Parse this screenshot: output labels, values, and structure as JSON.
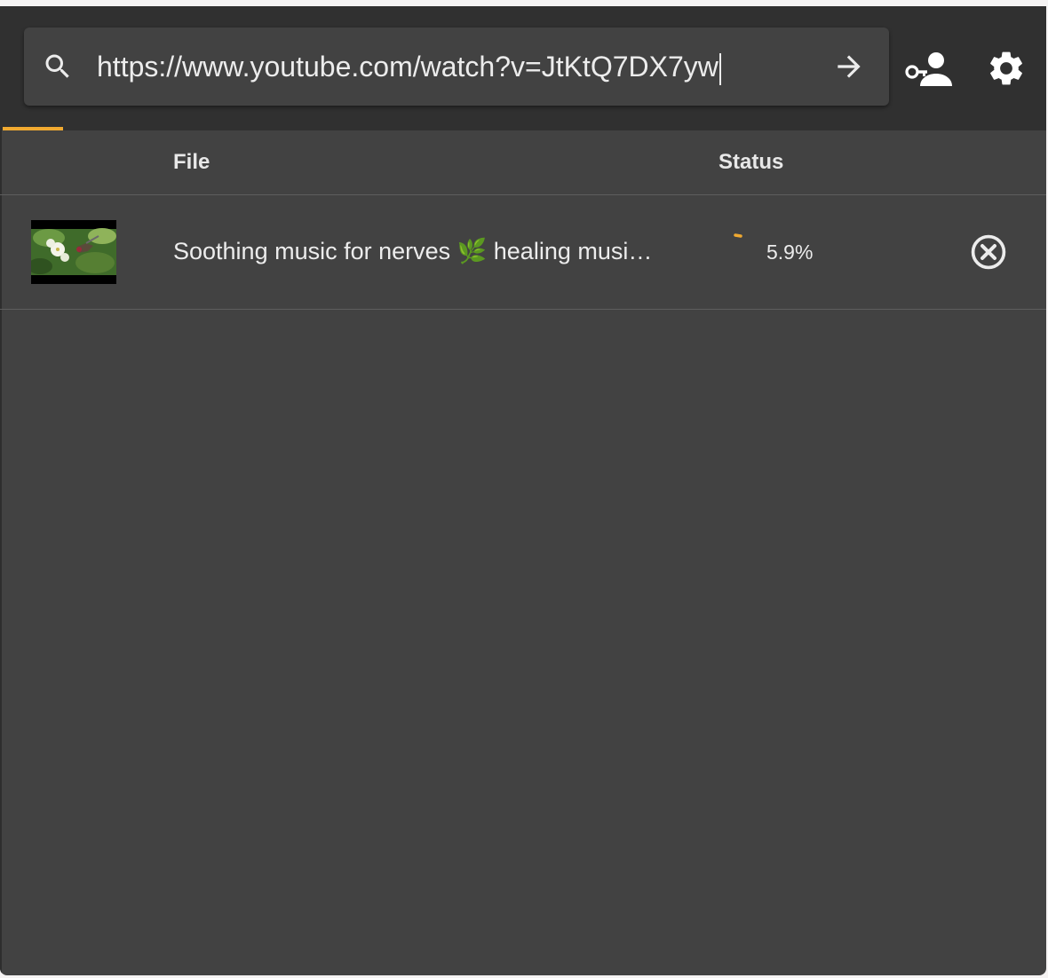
{
  "search": {
    "url_value": "https://www.youtube.com/watch?v=JtKtQ7DX7yw",
    "search_icon": "search-icon",
    "go_icon": "arrow-right-icon"
  },
  "toolbar": {
    "account_icon": "key-user-icon",
    "settings_icon": "gear-icon"
  },
  "table": {
    "headers": {
      "file": "File",
      "status": "Status"
    },
    "rows": [
      {
        "title": "Soothing music for nerves 🌿 healing musi…",
        "progress_text": "5.9%",
        "progress": 0.059,
        "cancel_icon": "cancel-circle-icon"
      }
    ]
  },
  "colors": {
    "accent": "#f0a930",
    "header_bg": "#303030",
    "content_bg": "#424242",
    "text": "#ececec"
  }
}
